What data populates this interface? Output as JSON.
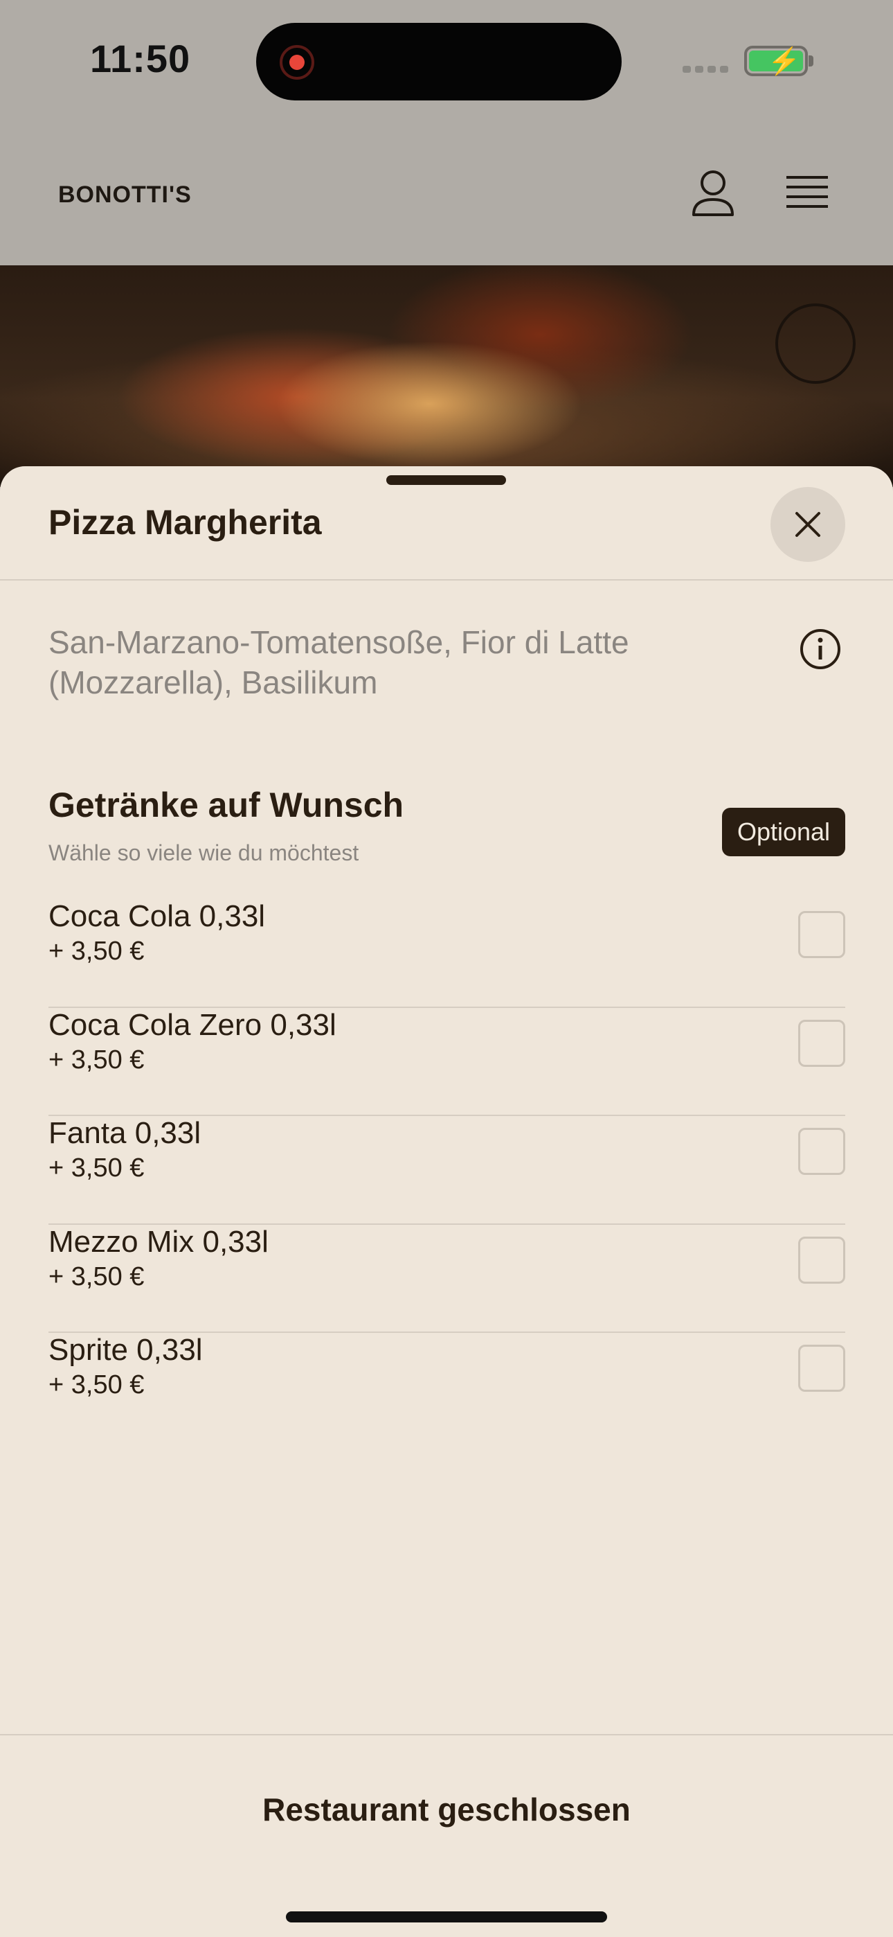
{
  "status_bar": {
    "time": "11:50"
  },
  "header": {
    "brand": "BONOTTI'S",
    "user_icon": "person-icon",
    "menu_icon": "hamburger-menu-icon"
  },
  "sheet": {
    "title": "Pizza Margherita",
    "description": "San-Marzano-Tomatensoße, Fior di Latte (Mozzarella), Basilikum",
    "option_group": {
      "title": "Getränke auf Wunsch",
      "subtitle": "Wähle so viele wie du möchtest",
      "badge": "Optional",
      "options": [
        {
          "name": "Coca Cola 0,33l",
          "price": "+ 3,50 €",
          "checked": false
        },
        {
          "name": "Coca Cola Zero 0,33l",
          "price": "+ 3,50 €",
          "checked": false
        },
        {
          "name": "Fanta 0,33l",
          "price": "+ 3,50 €",
          "checked": false
        },
        {
          "name": "Mezzo Mix 0,33l",
          "price": "+ 3,50 €",
          "checked": false
        },
        {
          "name": "Sprite 0,33l",
          "price": "+ 3,50 €",
          "checked": false
        }
      ]
    },
    "footer_label": "Restaurant geschlossen"
  },
  "colors": {
    "background_sheet": "#efe6da",
    "text_dark": "#2a1e12",
    "text_muted": "#8a8580",
    "battery_green": "#45c561"
  }
}
